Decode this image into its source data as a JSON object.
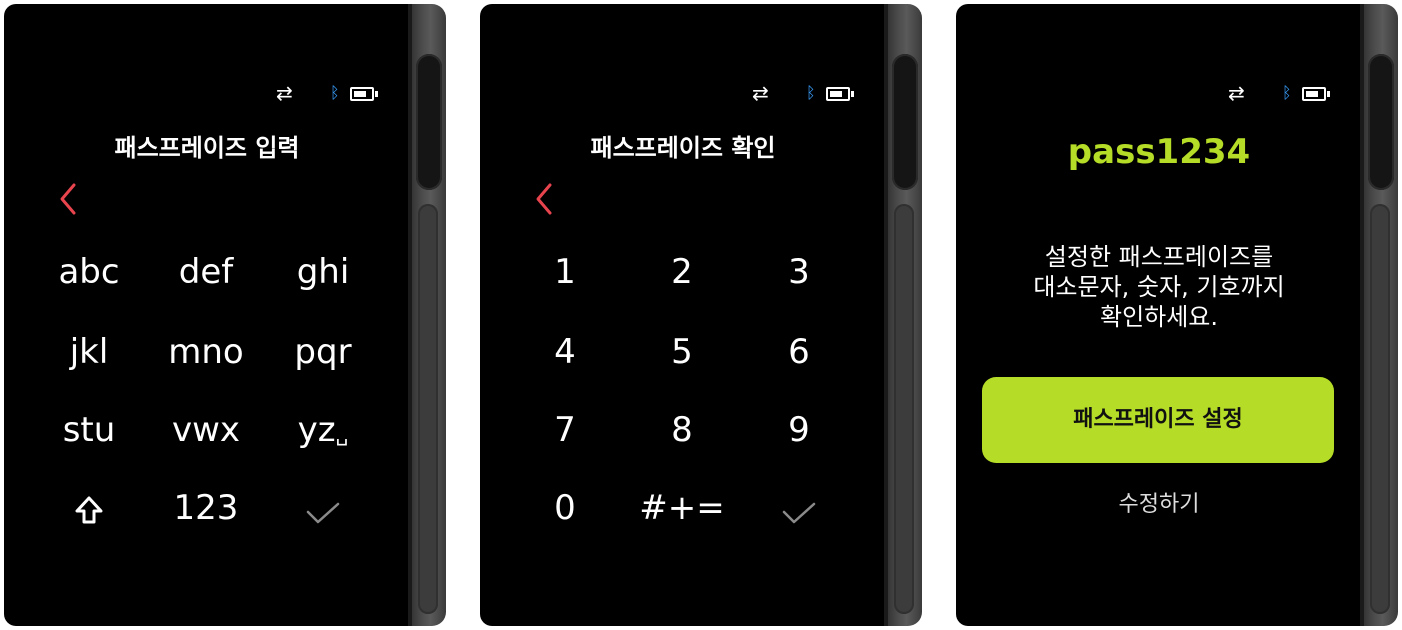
{
  "colors": {
    "accent": "#b5dc26",
    "back_arrow": "#e8444e",
    "bluetooth": "#3aa0ff",
    "confirm_disabled": "#8a8a8a"
  },
  "status_bar": {
    "swap_glyph": "⇄",
    "bluetooth_glyph": "ᛒ"
  },
  "screens": [
    {
      "title": "패스프레이즈 입력",
      "keys": [
        "abc",
        "def",
        "ghi",
        "jkl",
        "mno",
        "pqr",
        "stu",
        "vwx",
        "yz"
      ],
      "space_glyph": "␣",
      "mode_key": "123",
      "icons": [
        "back-chevron-icon",
        "shift-icon",
        "checkmark-icon"
      ]
    },
    {
      "title": "패스프레이즈 확인",
      "keys": [
        "1",
        "2",
        "3",
        "4",
        "5",
        "6",
        "7",
        "8",
        "9"
      ],
      "zero_key": "0",
      "symbol_key": "#+=",
      "icons": [
        "back-chevron-icon",
        "checkmark-icon"
      ]
    },
    {
      "passphrase": "pass1234",
      "description_lines": [
        "설정한 패스프레이즈를",
        "대소문자, 숫자, 기호까지",
        "확인하세요."
      ],
      "primary_button": "패스프레이즈 설정",
      "secondary_button": "수정하기"
    }
  ]
}
